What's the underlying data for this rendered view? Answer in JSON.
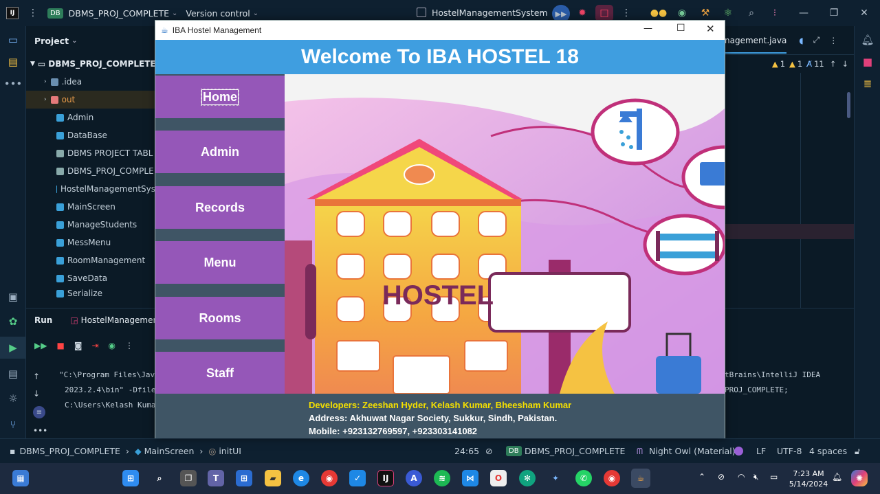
{
  "ide": {
    "project_badge": "DB",
    "project_name": "DBMS_PROJ_COMPLETE",
    "vcs": "Version control",
    "run_config": "HostelManagementSystem"
  },
  "project_panel": {
    "title": "Project",
    "root": "DBMS_PROJ_COMPLETE",
    "items": [
      ".idea",
      "out",
      "Admin",
      "DataBase",
      "DBMS PROJECT TABL",
      "DBMS_PROJ_COMPLE",
      "HostelManagementSys",
      "MainScreen",
      "ManageStudents",
      "MessMenu",
      "RoomManagement",
      "SaveData",
      "Serialize"
    ]
  },
  "editor": {
    "tab": "nagement.java",
    "warnings": "1",
    "weak_warnings": "1",
    "typos": "11"
  },
  "run_panel": {
    "run_label": "Run",
    "tab": "HostelManagementS",
    "lines": [
      "\"C:\\Program Files\\Jav",
      "2023.2.4\\bin\" -Dfile",
      "C:\\Users\\Kelash Kuma"
    ],
    "right_lines": [
      "tBrains\\IntelliJ IDEA",
      "PROJ_COMPLETE;"
    ]
  },
  "status_bar": {
    "crumbs": [
      "DBMS_PROJ_COMPLETE",
      "MainScreen",
      "initUI"
    ],
    "position": "24:65",
    "project_badge": "DB",
    "project": "DBMS_PROJ_COMPLETE",
    "theme": "Night Owl (Material)",
    "line_sep": "LF",
    "encoding": "UTF-8",
    "indent": "4 spaces"
  },
  "taskbar": {
    "time": "7:23 AM",
    "date": "5/14/2024"
  },
  "app": {
    "window_title": "IBA Hostel Management",
    "header": "Welcome To IBA HOSTEL 18",
    "nav": [
      "Home",
      "Admin",
      "Records",
      "Menu",
      "Rooms",
      "Staff"
    ],
    "hero_sign": "HOSTEL",
    "footer": {
      "developers_label": "Developers:",
      "developers": "Zeeshan Hyder, Kelash Kumar, Bheesham Kumar",
      "address": "Address: Akhuwat Nagar Society, Sukkur, Sindh, Pakistan.",
      "mobile": "Mobile: +923132769597, +923303141082"
    }
  },
  "colors": {
    "ide_bg": "#0b1a26",
    "header_blue": "#3f9ee0",
    "nav_purple": "#9557b8",
    "footer_slate": "#3f5565",
    "dev_yellow": "#f5e000"
  }
}
